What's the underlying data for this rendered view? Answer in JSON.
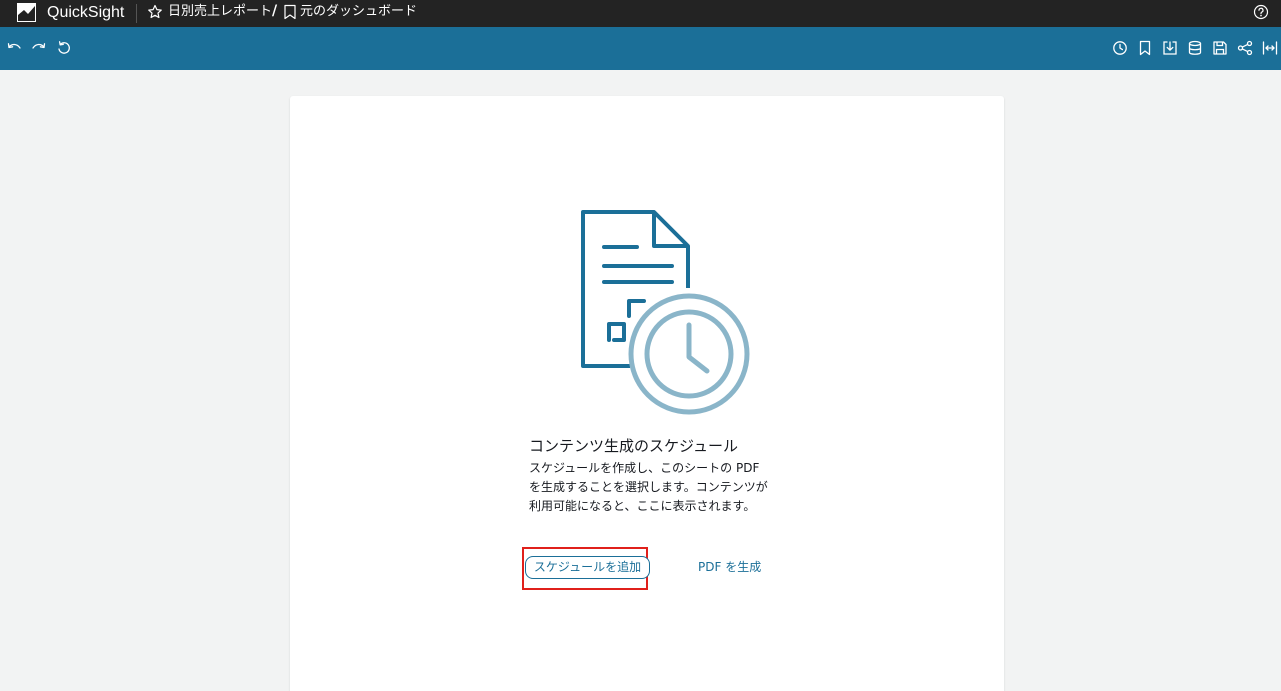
{
  "app": {
    "brand": "QuickSight"
  },
  "breadcrumb": {
    "analysis": "日別売上レポート",
    "separator": "/",
    "dashboard": "元のダッシュボード"
  },
  "toolbar": {
    "left_icons": [
      "undo-icon",
      "redo-icon",
      "reset-icon"
    ],
    "right_icons": [
      "clock-icon",
      "bookmark-icon",
      "export-icon",
      "database-icon",
      "save-icon",
      "share-icon",
      "fit-width-icon"
    ]
  },
  "schedule_panel": {
    "title": "コンテンツ生成のスケジュール",
    "description": "スケジュールを作成し、このシートの PDF を生成することを選択します。コンテンツが利用可能になると、ここに表示されます。",
    "add_schedule_label": "スケジュールを追加",
    "generate_pdf_label": "PDF を生成"
  },
  "colors": {
    "topbar": "#232323",
    "toolbar": "#1b6f98",
    "accent": "#1b6f98",
    "highlight": "#e0201b",
    "background": "#f2f3f3"
  }
}
